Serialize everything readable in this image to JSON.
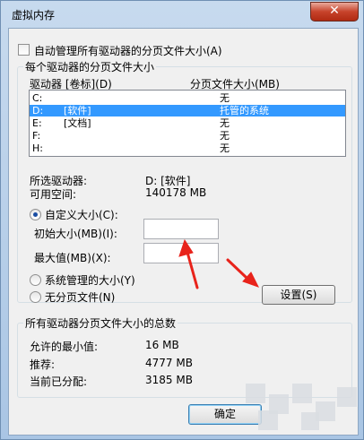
{
  "window": {
    "title": "虚拟内存",
    "close_symbol": "✕"
  },
  "auto_manage": {
    "label": "自动管理所有驱动器的分页文件大小(A)",
    "checked": false
  },
  "drives_group": {
    "title": "每个驱动器的分页文件大小",
    "header_drive": "驱动器 [卷标](D)",
    "header_size": "分页文件大小(MB)",
    "rows": [
      {
        "drive": "C:",
        "label": "",
        "size": "无",
        "selected": false
      },
      {
        "drive": "D:",
        "label": "[软件]",
        "size": "托管的系统",
        "selected": true
      },
      {
        "drive": "E:",
        "label": "[文档]",
        "size": "无",
        "selected": false
      },
      {
        "drive": "F:",
        "label": "",
        "size": "无",
        "selected": false
      },
      {
        "drive": "H:",
        "label": "",
        "size": "无",
        "selected": false
      }
    ],
    "selected_drive_label": "所选驱动器:",
    "selected_drive_value": "D:  [软件]",
    "free_space_label": "可用空间:",
    "free_space_value": "140178 MB",
    "custom_size_label": "自定义大小(C):",
    "initial_size_label": "初始大小(MB)(I):",
    "initial_size_value": "",
    "max_size_label": "最大值(MB)(X):",
    "max_size_value": "",
    "system_managed_label": "系统管理的大小(Y)",
    "no_paging_label": "无分页文件(N)",
    "set_button": "设置(S)"
  },
  "totals_group": {
    "title": "所有驱动器分页文件大小的总数",
    "min_label": "允许的最小值:",
    "min_value": "16 MB",
    "recommended_label": "推荐:",
    "recommended_value": "4777 MB",
    "allocated_label": "当前已分配:",
    "allocated_value": "3185 MB"
  },
  "footer": {
    "ok_button": "确定"
  },
  "colors": {
    "selection": "#3399ff",
    "annotation_arrow": "#e8231b"
  }
}
